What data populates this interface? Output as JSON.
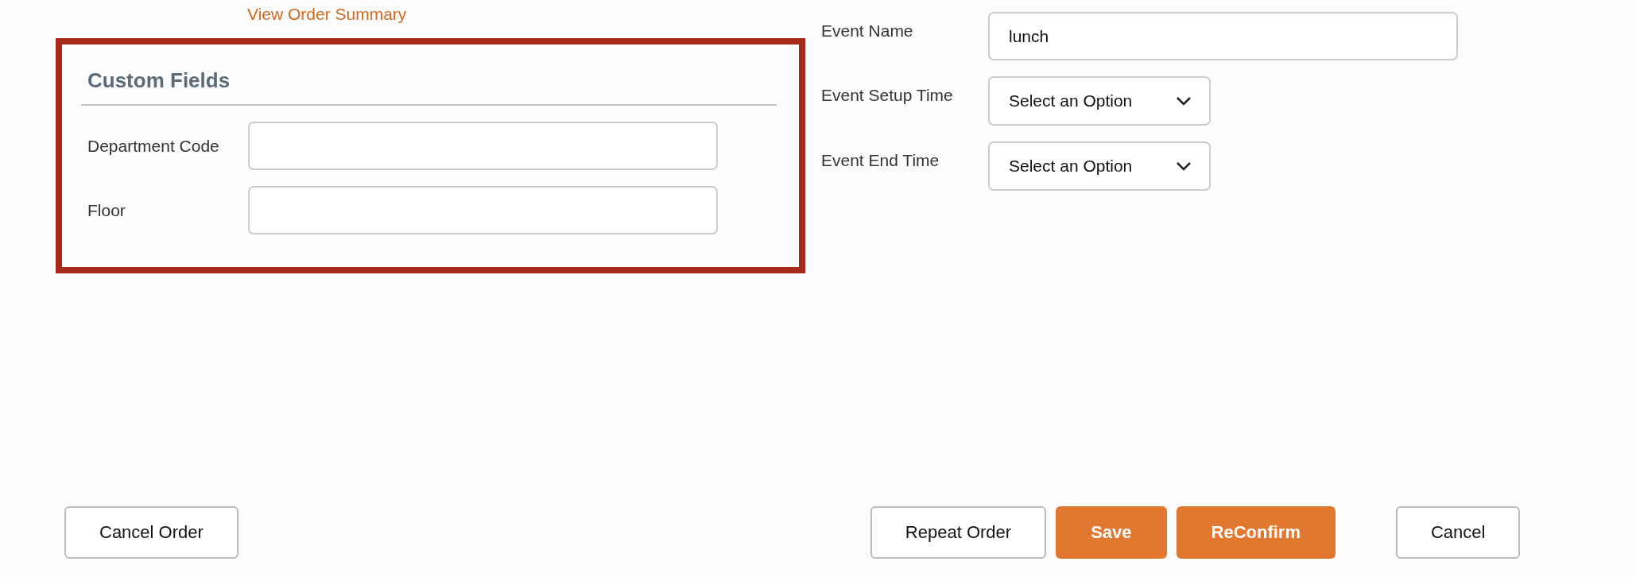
{
  "summary_link": "View Order Summary",
  "custom_fields": {
    "title": "Custom Fields",
    "fields": [
      {
        "label": "Department Code"
      },
      {
        "label": "Floor"
      }
    ]
  },
  "event_fields": [
    {
      "kind": "text",
      "label": "Event Name",
      "value": "lunch"
    },
    {
      "kind": "select",
      "label": "Event Setup Time",
      "value": "Select an Option"
    },
    {
      "kind": "select",
      "label": "Event End Time",
      "value": "Select an Option"
    }
  ],
  "left_buttons": [
    {
      "label": "Cancel Order",
      "kind": "secondary"
    }
  ],
  "right_buttons": [
    {
      "label": "Repeat Order",
      "kind": "secondary"
    },
    {
      "label": "Save",
      "kind": "primary"
    },
    {
      "label": "ReConfirm",
      "kind": "primary"
    },
    {
      "label": "Cancel",
      "kind": "secondary"
    }
  ]
}
